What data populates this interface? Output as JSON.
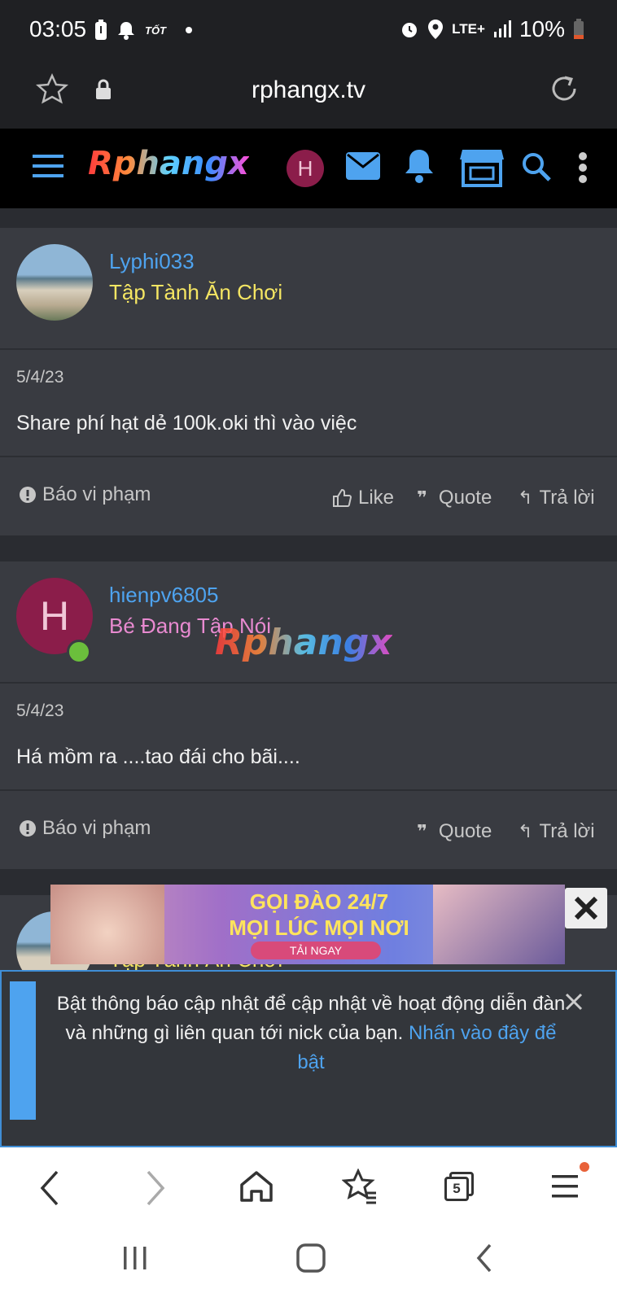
{
  "status_bar": {
    "time": "03:05",
    "left_icons": [
      "battery-saver-icon",
      "bell-icon",
      "tot-label",
      "dot-icon"
    ],
    "tot_text": "TỐT",
    "network": "LTE+",
    "battery": "10%"
  },
  "browser": {
    "url": "rphangx.tv",
    "tab_count": "5"
  },
  "site": {
    "logo_text": "Rphangx",
    "user_initial": "H"
  },
  "posts": [
    {
      "username": "Lyphi033",
      "user_title": "Tập Tành Ăn Chơi",
      "title_color": "#f5e663",
      "date": "5/4/23",
      "message": "Share phí hạt dẻ 100k.oki thì vào việc",
      "report_label": "Báo vi phạm",
      "like_label": "Like",
      "quote_label": "Quote",
      "reply_label": "Trả lời"
    },
    {
      "username": "hienpv6805",
      "avatar_initial": "H",
      "user_title": "Bé Đang Tập Nói",
      "title_color": "#e88ad0",
      "date": "5/4/23",
      "message": "Há mồm ra ....tao đái cho bãi....",
      "report_label": "Báo vi phạm",
      "quote_label": "Quote",
      "reply_label": "Trả lời"
    },
    {
      "user_title": "Tập Tành Ăn Chơi"
    }
  ],
  "watermark": "Rphangx",
  "ad": {
    "line1": "GỌI ĐÀO 24/7",
    "line2": "MỌI LÚC MỌI NƠI",
    "cta": "TẢI NGAY"
  },
  "notice": {
    "text": "Bật thông báo cập nhật để cập nhật về hoạt động diễn đàn và những gì liên quan tới nick của bạn.",
    "link_text": "Nhấn vào đây để bật"
  },
  "colors": {
    "accent": "#4ea3ef",
    "background": "#2a2c31",
    "panel": "#393b41"
  }
}
